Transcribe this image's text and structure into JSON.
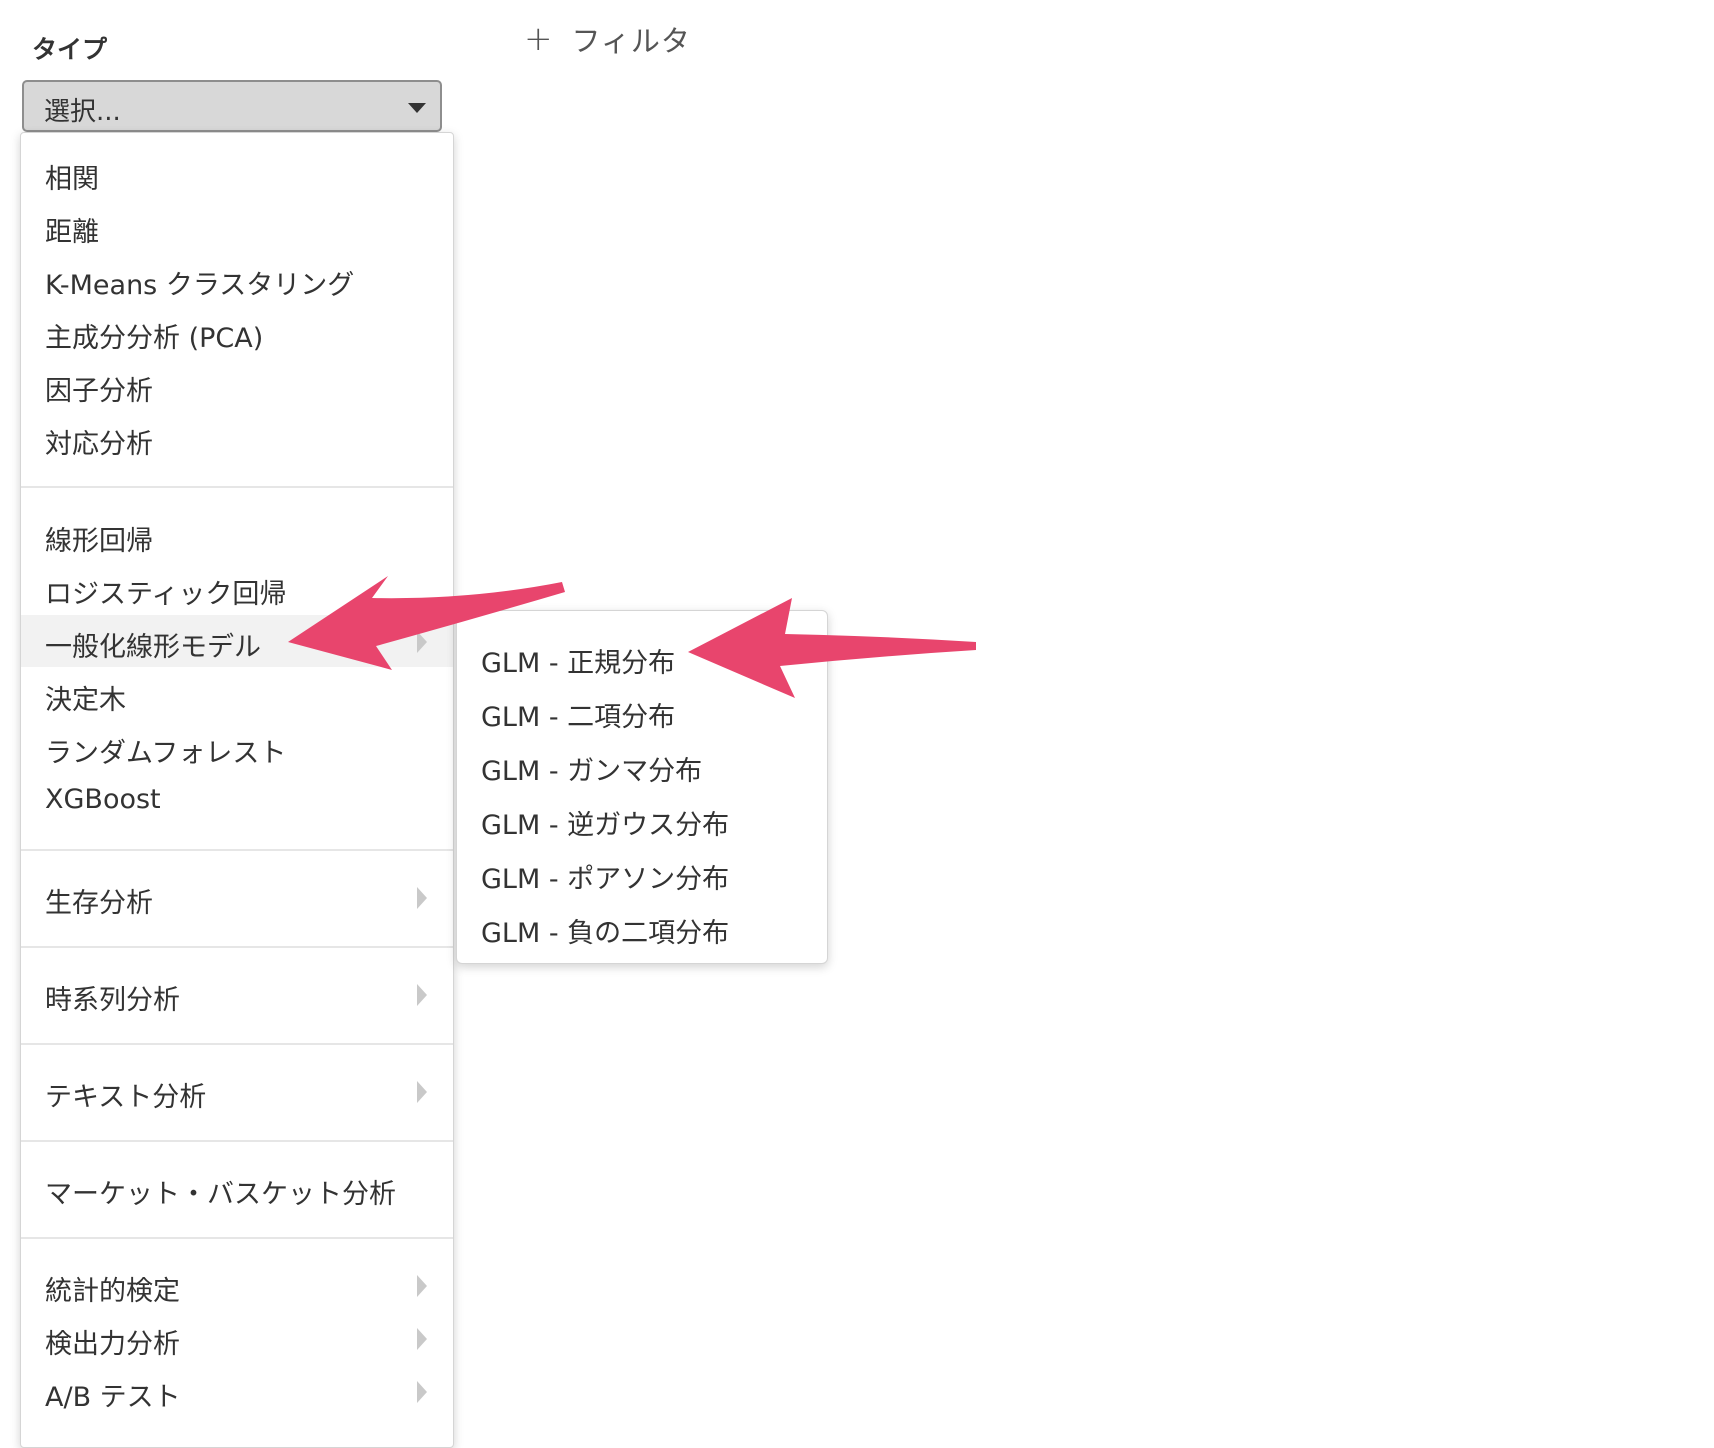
{
  "header": {
    "type_label": "タイプ",
    "filter_label": "フィルタ",
    "filter_icon": "plus-icon"
  },
  "select": {
    "value": "選択..."
  },
  "menu": {
    "group1": [
      "相関",
      "距離",
      "K-Means クラスタリング",
      "主成分分析 (PCA)",
      "因子分析",
      "対応分析"
    ],
    "group2": [
      "線形回帰",
      "ロジスティック回帰",
      "一般化線形モデル",
      "決定木",
      "ランダムフォレスト",
      "XGBoost"
    ],
    "group3": [
      "生存分析"
    ],
    "group4": [
      "時系列分析"
    ],
    "group5": [
      "テキスト分析"
    ],
    "group6": [
      "マーケット・バスケット分析"
    ],
    "group7": [
      "統計的検定",
      "検出力分析",
      "A/B テスト"
    ]
  },
  "submenu": {
    "items": [
      "GLM - 正規分布",
      "GLM - 二項分布",
      "GLM - ガンマ分布",
      "GLM - 逆ガウス分布",
      "GLM - ポアソン分布",
      "GLM - 負の二項分布"
    ]
  },
  "annotations": {
    "arrow_color": "#e8456d"
  }
}
